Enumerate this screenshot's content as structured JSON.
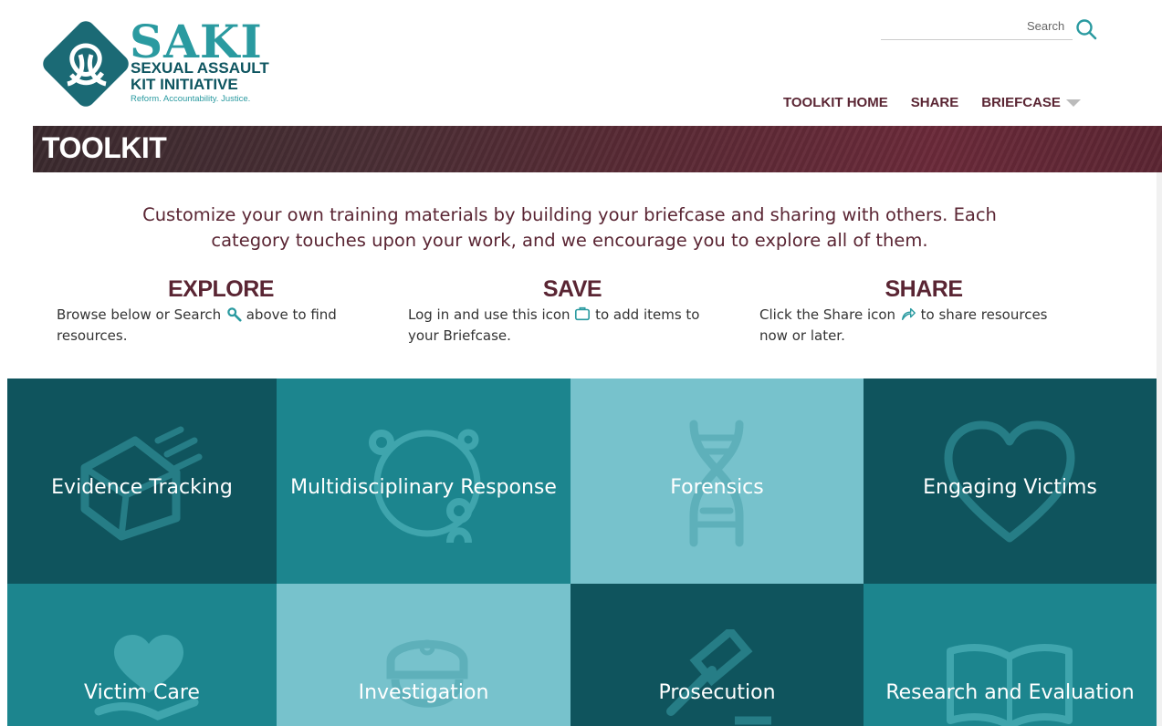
{
  "logo": {
    "name": "SAKI",
    "line1": "SEXUAL ASSAULT",
    "line2": "KIT INITIATIVE",
    "tagline": "Reform. Accountability. Justice."
  },
  "search": {
    "label": "Search",
    "icon": "search-icon"
  },
  "nav": [
    {
      "label": "TOOLKIT HOME"
    },
    {
      "label": "SHARE"
    },
    {
      "label": "BRIEFCASE"
    }
  ],
  "banner": {
    "title": "TOOLKIT"
  },
  "intro": {
    "line1": "Customize your own training materials by building your briefcase and sharing with others. Each",
    "line2": "category touches upon your work, and we encourage you to explore all of them."
  },
  "columns": [
    {
      "title": "EXPLORE",
      "before": "Browse below or Search",
      "after": "above to find",
      "line2": "resources.",
      "icon": "search-icon"
    },
    {
      "title": "SAVE",
      "before": "Log in and use this icon",
      "after": "to add items to",
      "line2": "your Briefcase.",
      "icon": "briefcase-icon"
    },
    {
      "title": "SHARE",
      "before": "Click the Share icon",
      "after": "to share resources",
      "line2": "now or later.",
      "icon": "share-icon"
    }
  ],
  "tiles": [
    {
      "label": "Evidence Tracking",
      "icon": "evidence-box-icon"
    },
    {
      "label": "Multidisciplinary Response",
      "icon": "team-cycle-icon"
    },
    {
      "label": "Forensics",
      "icon": "dna-icon"
    },
    {
      "label": "Engaging Victims",
      "icon": "heart-icon"
    },
    {
      "label": "Victim Care",
      "icon": "heart-hand-icon"
    },
    {
      "label": "Investigation",
      "icon": "police-icon"
    },
    {
      "label": "Prosecution",
      "icon": "gavel-icon"
    },
    {
      "label": "Research and Evaluation",
      "icon": "book-icon"
    }
  ],
  "colors": {
    "maroon": "#5a2533",
    "teal_dark": "#0f545d",
    "teal_mid": "#1c858e",
    "teal_light": "#77c2cc",
    "accent": "#2a9aa0"
  }
}
